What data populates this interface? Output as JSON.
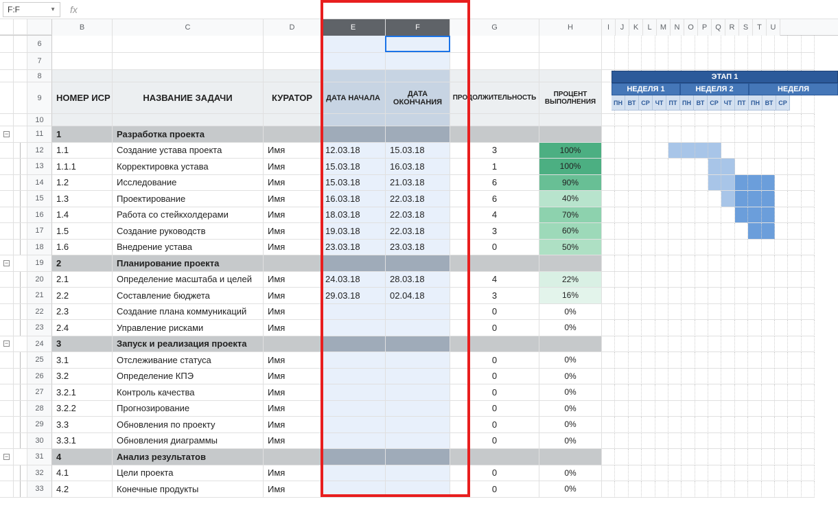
{
  "namebox": "F:F",
  "fx": "fx",
  "cols": {
    "B": "B",
    "C": "C",
    "D": "D",
    "E": "E",
    "F": "F",
    "G": "G",
    "H": "H",
    "I": "I",
    "J": "J",
    "K": "K",
    "L": "L",
    "M": "M",
    "N": "N",
    "O": "O",
    "P": "P",
    "Q": "Q",
    "R": "R",
    "S": "S",
    "T": "T",
    "U": "U"
  },
  "headers": {
    "wbs": "НОМЕР ИСР",
    "task": "НАЗВАНИЕ ЗАДАЧИ",
    "curator": "КУРАТОР",
    "start": "ДАТА НАЧАЛА",
    "end": "ДАТА ОКОНЧАНИЯ",
    "dur": "ПРОДОЛЖИТЕЛЬНОСТЬ",
    "pct": "ПРОЦЕНТ ВЫПОЛНЕНИЯ",
    "stage": "ЭТАП 1",
    "w1": "НЕДЕЛЯ 1",
    "w2": "НЕДЕЛЯ 2",
    "w3": "НЕДЕЛЯ"
  },
  "days": [
    "ПН",
    "ВТ",
    "СР",
    "ЧТ",
    "ПТ",
    "ПН",
    "ВТ",
    "СР",
    "ЧТ",
    "ПТ",
    "ПН",
    "ВТ",
    "СР"
  ],
  "rows": [
    {
      "n": "6",
      "type": "blank"
    },
    {
      "n": "7",
      "type": "blank"
    },
    {
      "n": "8",
      "type": "h1"
    },
    {
      "n": "9",
      "type": "h2"
    },
    {
      "n": "10",
      "type": "h3"
    },
    {
      "n": "11",
      "type": "sec",
      "wbs": "1",
      "task": "Разработка проекта"
    },
    {
      "n": "12",
      "wbs": "1.1",
      "task": "Создание устава проекта",
      "cur": "Имя",
      "s": "12.03.18",
      "e": "15.03.18",
      "d": "3",
      "p": "100%",
      "pc": "#4caf82",
      "g": [
        5,
        6,
        7,
        8
      ]
    },
    {
      "n": "13",
      "wbs": "1.1.1",
      "task": "Корректировка устава",
      "cur": "Имя",
      "s": "15.03.18",
      "e": "16.03.18",
      "d": "1",
      "p": "100%",
      "pc": "#4caf82",
      "g": [
        8,
        9
      ]
    },
    {
      "n": "14",
      "wbs": "1.2",
      "task": "Исследование",
      "cur": "Имя",
      "s": "15.03.18",
      "e": "21.03.18",
      "d": "6",
      "p": "90%",
      "pc": "#68bf95",
      "g": [
        8,
        9,
        10,
        11,
        12
      ]
    },
    {
      "n": "15",
      "wbs": "1.3",
      "task": "Проектирование",
      "cur": "Имя",
      "s": "16.03.18",
      "e": "22.03.18",
      "d": "6",
      "p": "40%",
      "pc": "#b8e4cd",
      "g": [
        9,
        10,
        11,
        12
      ]
    },
    {
      "n": "16",
      "wbs": "1.4",
      "task": "Работа со стейкхолдерами",
      "cur": "Имя",
      "s": "18.03.18",
      "e": "22.03.18",
      "d": "4",
      "p": "70%",
      "pc": "#8dd2ae",
      "g": [
        10,
        11,
        12
      ]
    },
    {
      "n": "17",
      "wbs": "1.5",
      "task": "Создание руководств",
      "cur": "Имя",
      "s": "19.03.18",
      "e": "22.03.18",
      "d": "3",
      "p": "60%",
      "pc": "#9dd9b9",
      "g": [
        11,
        12
      ]
    },
    {
      "n": "18",
      "wbs": "1.6",
      "task": "Внедрение устава",
      "cur": "Имя",
      "s": "23.03.18",
      "e": "23.03.18",
      "d": "0",
      "p": "50%",
      "pc": "#aee0c4"
    },
    {
      "n": "19",
      "type": "sec",
      "wbs": "2",
      "task": "Планирование проекта"
    },
    {
      "n": "20",
      "wbs": "2.1",
      "task": "Определение масштаба и целей",
      "cur": "Имя",
      "s": "24.03.18",
      "e": "28.03.18",
      "d": "4",
      "p": "22%",
      "pc": "#d9f0e4"
    },
    {
      "n": "21",
      "wbs": "2.2",
      "task": "Составление бюджета",
      "cur": "Имя",
      "s": "29.03.18",
      "e": "02.04.18",
      "d": "3",
      "p": "16%",
      "pc": "#e3f4eb"
    },
    {
      "n": "22",
      "wbs": "2.3",
      "task": "Создание плана коммуникаций",
      "cur": "Имя",
      "d": "0",
      "p": "0%"
    },
    {
      "n": "23",
      "wbs": "2.4",
      "task": "Управление рисками",
      "cur": "Имя",
      "d": "0",
      "p": "0%"
    },
    {
      "n": "24",
      "type": "sec",
      "wbs": "3",
      "task": "Запуск и реализация проекта"
    },
    {
      "n": "25",
      "wbs": "3.1",
      "task": "Отслеживание статуса",
      "cur": "Имя",
      "d": "0",
      "p": "0%"
    },
    {
      "n": "26",
      "wbs": "3.2",
      "task": "Определение КПЭ",
      "cur": "Имя",
      "d": "0",
      "p": "0%"
    },
    {
      "n": "27",
      "wbs": "3.2.1",
      "task": "Контроль качества",
      "cur": "Имя",
      "d": "0",
      "p": "0%"
    },
    {
      "n": "28",
      "wbs": "3.2.2",
      "task": "Прогнозирование",
      "cur": "Имя",
      "d": "0",
      "p": "0%"
    },
    {
      "n": "29",
      "wbs": "3.3",
      "task": "Обновления по проекту",
      "cur": "Имя",
      "d": "0",
      "p": "0%"
    },
    {
      "n": "30",
      "wbs": "3.3.1",
      "task": "Обновления диаграммы",
      "cur": "Имя",
      "d": "0",
      "p": "0%"
    },
    {
      "n": "31",
      "type": "sec",
      "wbs": "4",
      "task": "Анализ результатов"
    },
    {
      "n": "32",
      "wbs": "4.1",
      "task": "Цели проекта",
      "cur": "Имя",
      "d": "0",
      "p": "0%"
    },
    {
      "n": "33",
      "wbs": "4.2",
      "task": "Конечные продукты",
      "cur": "Имя",
      "d": "0",
      "p": "0%"
    }
  ]
}
